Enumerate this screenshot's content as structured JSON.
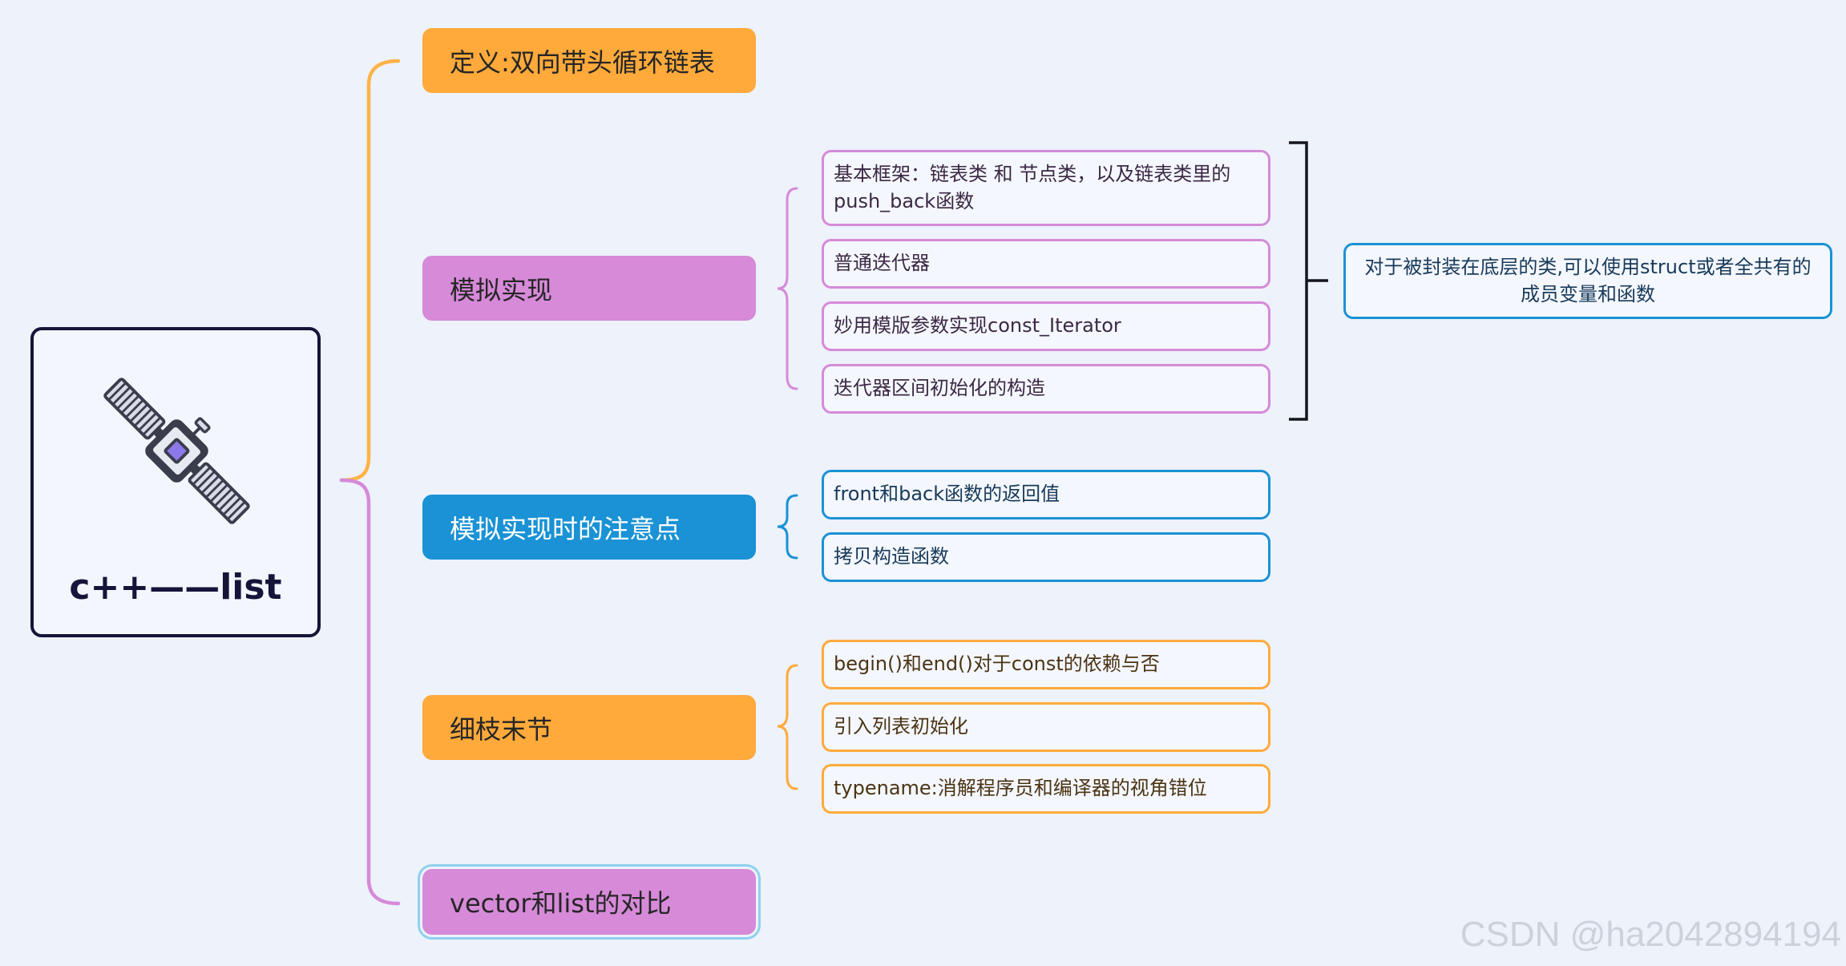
{
  "root": {
    "title": "c++——list",
    "icon": "satellite-icon"
  },
  "branches": [
    {
      "label": "定义:双向带头循环链表",
      "color": "#FFAA3B"
    },
    {
      "label": "模拟实现",
      "color": "#D68AD8",
      "children": [
        {
          "label": "基本框架：链表类 和 节点类，以及链表类里的push_back函数"
        },
        {
          "label": "普通迭代器"
        },
        {
          "label": "妙用模版参数实现const_Iterator"
        },
        {
          "label": "迭代器区间初始化的构造"
        }
      ],
      "summary": "对于被封装在底层的类,可以使用struct或者全共有的成员变量和函数"
    },
    {
      "label": "模拟实现时的注意点",
      "color": "#1A92D5",
      "children": [
        {
          "label": "front和back函数的返回值"
        },
        {
          "label": "拷贝构造函数"
        }
      ]
    },
    {
      "label": "细枝末节",
      "color": "#FFAA3B",
      "children": [
        {
          "label": "begin()和end()对于const的依赖与否"
        },
        {
          "label": "引入列表初始化"
        },
        {
          "label": "typename:消解程序员和编译器的视角错位"
        }
      ]
    },
    {
      "label": "vector和list的对比",
      "color": "#D68AD8",
      "selected": true
    }
  ],
  "colors": {
    "background": "#EDF2FB",
    "orange": "#FFAA3B",
    "purple": "#D68AD8",
    "blue": "#1A92D5",
    "root_border": "#15153A",
    "selection": "#8FD0EF"
  },
  "watermark": "CSDN @ha2042894194"
}
